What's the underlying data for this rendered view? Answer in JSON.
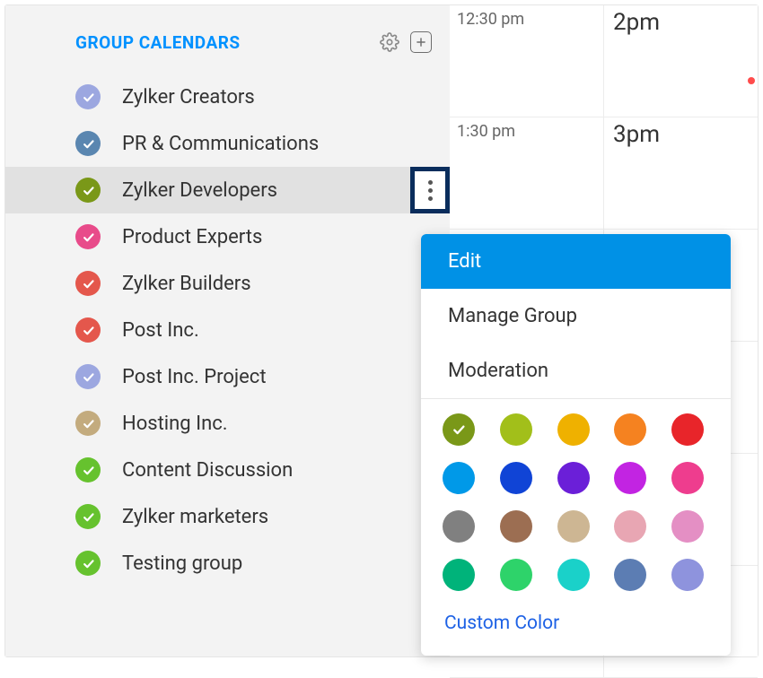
{
  "sidebar": {
    "title": "GROUP CALENDARS",
    "items": [
      {
        "label": "Zylker Creators",
        "color": "#9ca7e0"
      },
      {
        "label": "PR & Communications",
        "color": "#5a86b0"
      },
      {
        "label": "Zylker Developers",
        "color": "#7a9818",
        "selected": true
      },
      {
        "label": "Product Experts",
        "color": "#e84b8a"
      },
      {
        "label": "Zylker Builders",
        "color": "#e4574c"
      },
      {
        "label": "Post Inc.",
        "color": "#e4574c"
      },
      {
        "label": "Post Inc. Project",
        "color": "#9ca7e0"
      },
      {
        "label": "Hosting Inc.",
        "color": "#c3ab7e"
      },
      {
        "label": "Content Discussion",
        "color": "#66c22e"
      },
      {
        "label": "Zylker marketers",
        "color": "#66c22e"
      },
      {
        "label": "Testing group",
        "color": "#66c22e"
      }
    ]
  },
  "calendar": {
    "rows": [
      {
        "small": "12:30 pm",
        "large": "2pm"
      },
      {
        "small": "1:30 pm",
        "large": "3pm"
      }
    ]
  },
  "context_menu": {
    "items": [
      {
        "label": "Edit",
        "highlighted": true
      },
      {
        "label": "Manage Group"
      },
      {
        "label": "Moderation"
      }
    ],
    "colors": [
      "#7a9818",
      "#a2bf1a",
      "#efb100",
      "#f58220",
      "#e8252a",
      "#0099e8",
      "#1044d6",
      "#6b1fd8",
      "#c224e2",
      "#ee3d8e",
      "#808080",
      "#9c6e52",
      "#cdb693",
      "#e8a6b3",
      "#e48fc4",
      "#00b37a",
      "#2ed36a",
      "#1ad1c9",
      "#5c7db3",
      "#8e93dd"
    ],
    "custom_color_label": "Custom Color",
    "selected_color_index": 0
  }
}
